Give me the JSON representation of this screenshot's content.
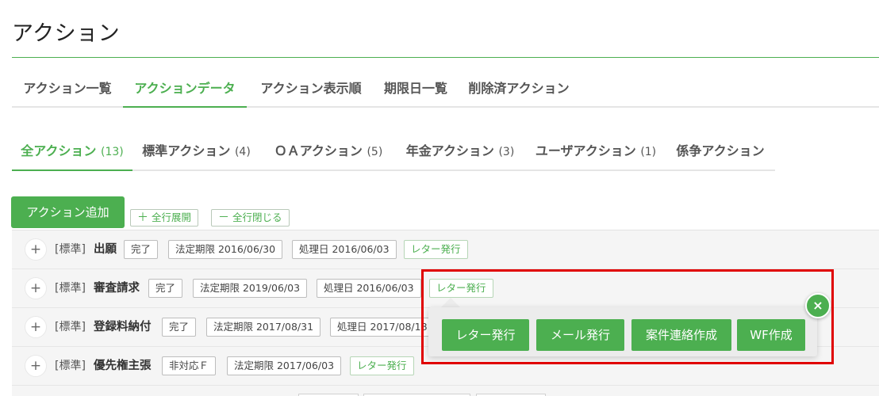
{
  "page": {
    "title": "アクション"
  },
  "main_tabs": [
    {
      "label": "アクション一覧"
    },
    {
      "label": "アクションデータ",
      "active": true
    },
    {
      "label": "アクション表示順"
    },
    {
      "label": "期限日一覧"
    },
    {
      "label": "削除済アクション"
    }
  ],
  "sub_tabs": [
    {
      "label": "全アクション",
      "count": "(13)",
      "active": true
    },
    {
      "label": "標準アクション",
      "count": "(4)"
    },
    {
      "label": "ＯＡアクション",
      "count": "(5)"
    },
    {
      "label": "年金アクション",
      "count": "(3)"
    },
    {
      "label": "ユーザアクション",
      "count": "(1)"
    },
    {
      "label": "係争アクション",
      "count": ""
    }
  ],
  "toolbar": {
    "add_label": "アクション追加",
    "expand_label": "全行展開",
    "expand_symbol": "＋",
    "collapse_label": "全行閉じる",
    "collapse_symbol": "－"
  },
  "rows": [
    {
      "toggle": "+",
      "category": "[標準]",
      "name": "出願",
      "status": "完了",
      "legal_deadline": "法定期限 2016/06/30",
      "processed": "処理日 2016/06/03",
      "letter": "レター発行"
    },
    {
      "toggle": "+",
      "category": "[標準]",
      "name": "審査請求",
      "status": "完了",
      "legal_deadline": "法定期限 2019/06/03",
      "processed": "処理日 2016/06/03",
      "letter": "レター発行"
    },
    {
      "toggle": "+",
      "category": "[標準]",
      "name": "登録料納付",
      "status": "完了",
      "legal_deadline": "法定期限 2017/08/31",
      "processed": "処理日 2017/08/18",
      "letter": ""
    },
    {
      "toggle": "+",
      "category": "[標準]",
      "name": "優先権主張",
      "status": "非対応Ｆ",
      "legal_deadline": "法定期限 2017/06/03",
      "processed": "",
      "letter": "レター発行"
    }
  ],
  "popup": {
    "close_symbol": "×",
    "buttons": [
      {
        "label": "レター発行"
      },
      {
        "label": "メール発行"
      },
      {
        "label": "案件連絡作成"
      },
      {
        "label": "WF作成"
      }
    ]
  },
  "colors": {
    "accent": "#4caf50",
    "highlight": "#e00000"
  },
  "icons": {
    "close": "close-icon",
    "plus": "plus-icon",
    "minus": "minus-icon"
  }
}
